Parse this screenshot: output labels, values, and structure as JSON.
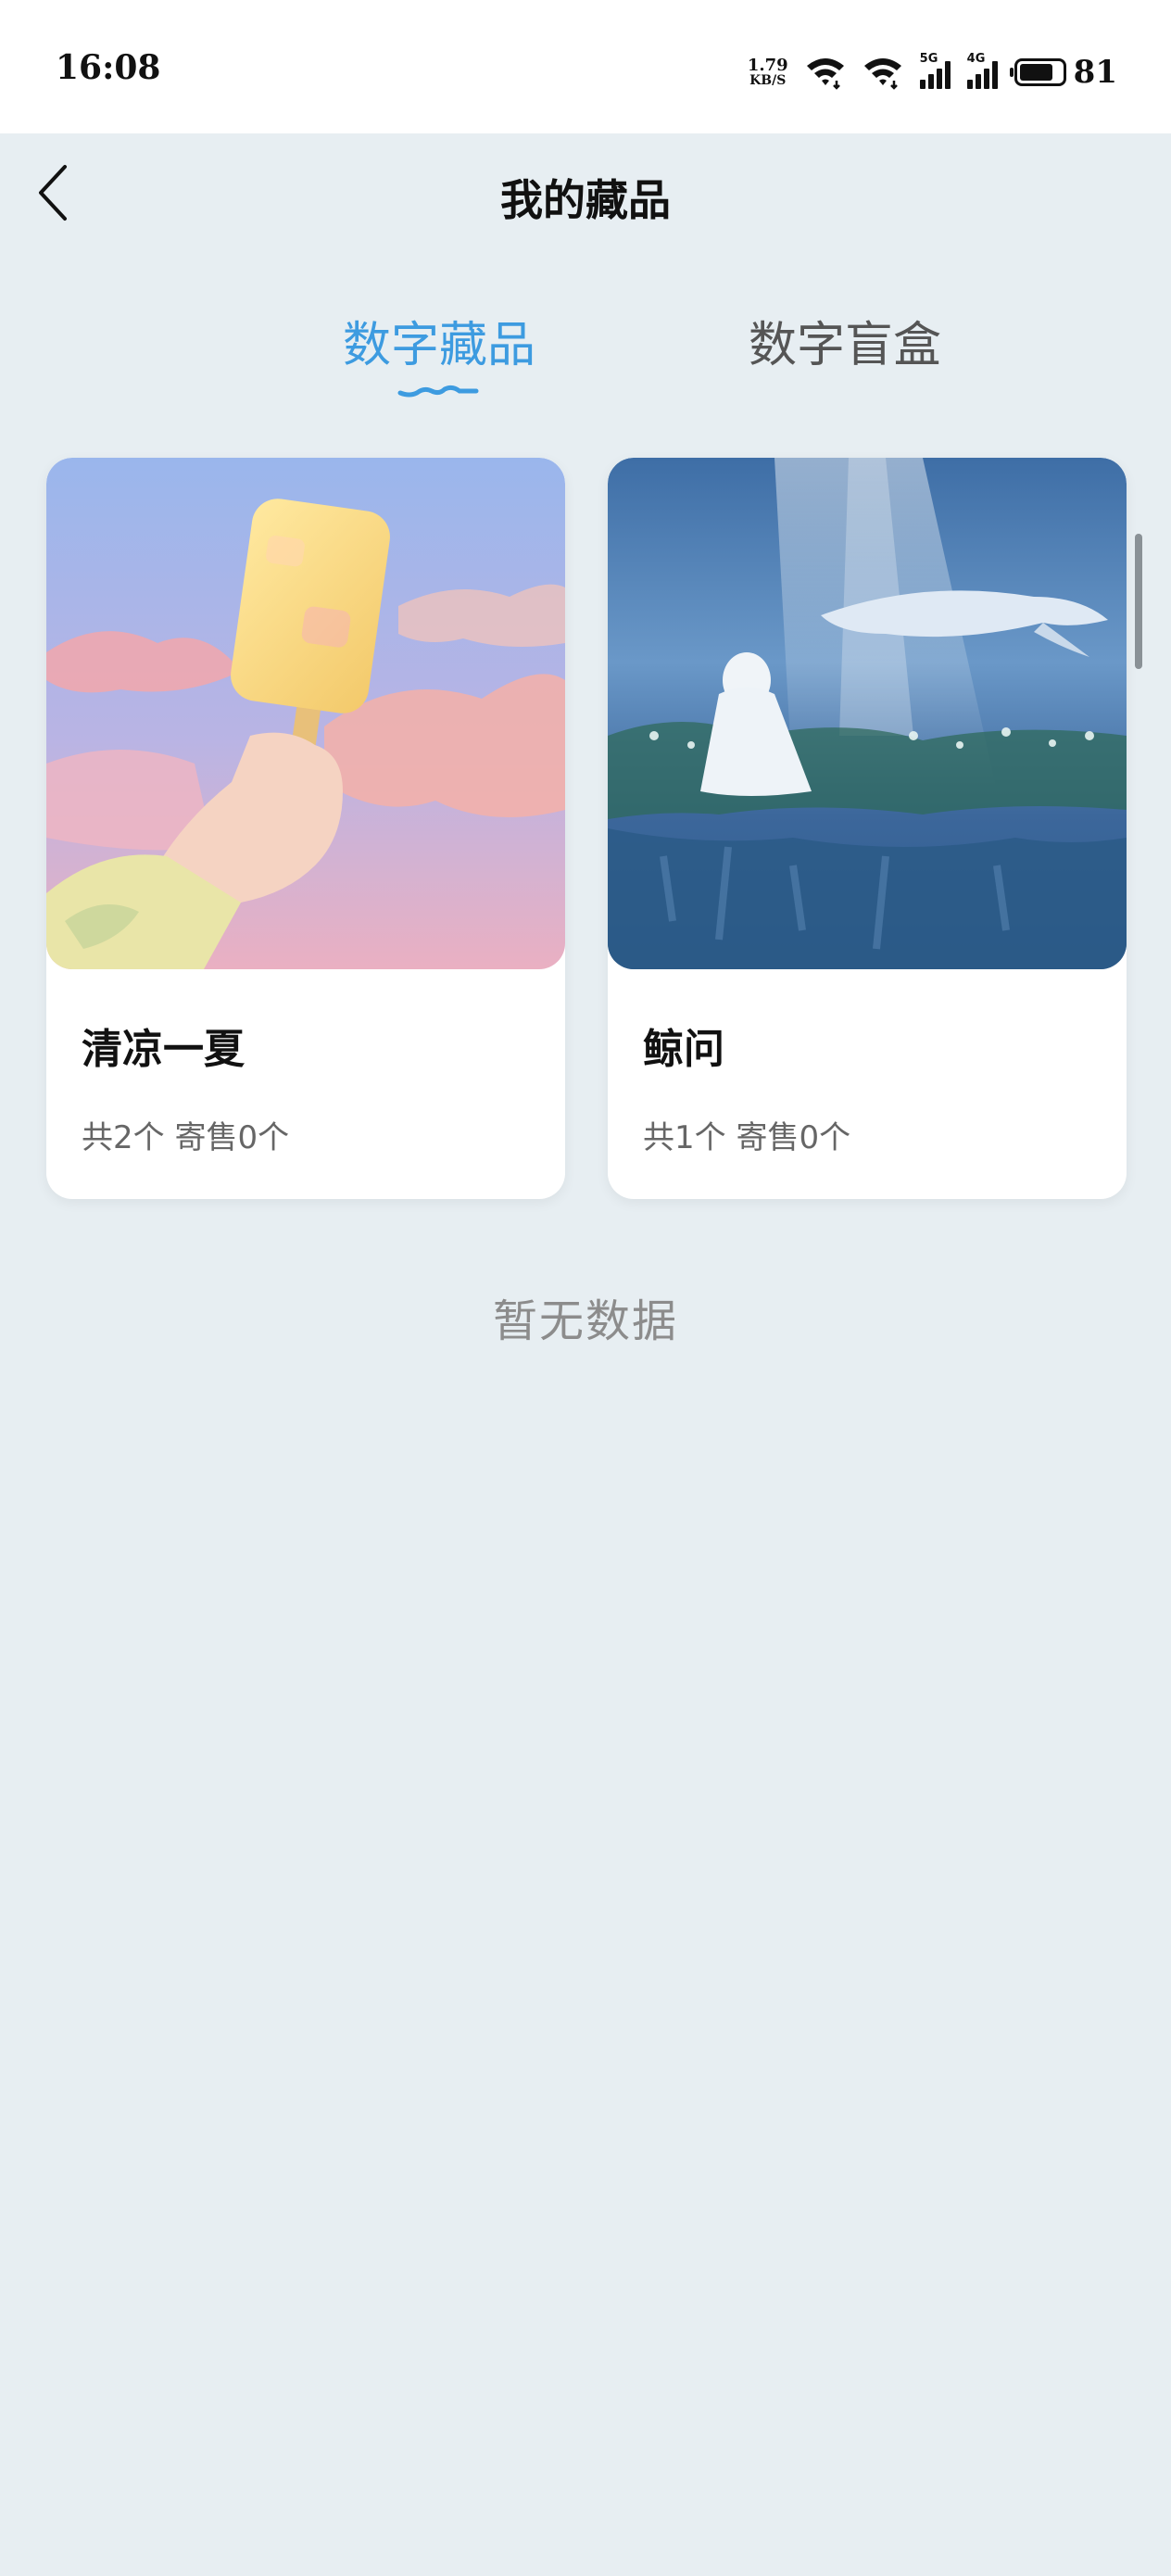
{
  "status_bar": {
    "time": "16:08",
    "net_speed_value": "1.79",
    "net_speed_unit": "KB/S",
    "sim1_label": "5G",
    "sim2_label": "4G",
    "battery": "81"
  },
  "header": {
    "title": "我的藏品"
  },
  "tabs": [
    {
      "label": "数字藏品",
      "active": true
    },
    {
      "label": "数字盲盒",
      "active": false
    }
  ],
  "items": [
    {
      "name": "清凉一夏",
      "stats": "共2个 寄售0个",
      "image": "popsicle-in-sky-painting"
    },
    {
      "name": "鲸问",
      "stats": "共1个 寄售0个",
      "image": "girl-with-whale-painting"
    }
  ],
  "empty_text": "暂无数据",
  "colors": {
    "accent": "#3d9be0",
    "background": "#e7eef2"
  }
}
